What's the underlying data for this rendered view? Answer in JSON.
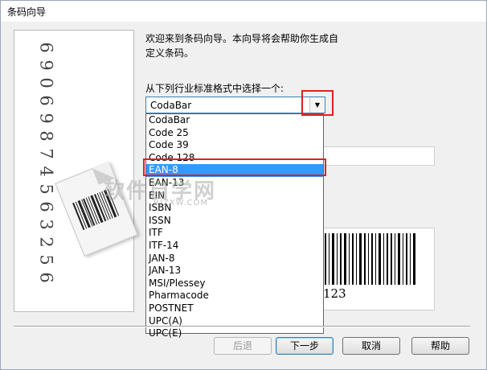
{
  "window": {
    "title": "条码向导"
  },
  "intro_text": "欢迎来到条码向导。本向导将会帮助你生成自定义条码。",
  "select_label": "从下列行业标准格式中选择一个:",
  "select": {
    "value": "CodaBar",
    "arrow_icon": "chevron-down-icon"
  },
  "list": {
    "items": [
      "CodaBar",
      "Code 25",
      "Code 39",
      "Code 128",
      "EAN-8",
      "EAN-13",
      "EIN",
      "ISBN",
      "ISSN",
      "ITF",
      "ITF-14",
      "JAN-8",
      "JAN-13",
      "MSI/Plessey",
      "Pharmacode",
      "POSTNET",
      "UPC(A)",
      "UPC(E)"
    ],
    "selected": "EAN-8"
  },
  "left_panel": {
    "digits": [
      "6",
      "9",
      "0",
      "6",
      "9",
      "8",
      "7",
      "4",
      "5",
      "6",
      "3",
      "2",
      "5",
      "6"
    ]
  },
  "preview": {
    "text": "123"
  },
  "watermark": {
    "main": "软件自学网",
    "sub": "RJZXW.COM"
  },
  "buttons": {
    "back": "后退",
    "next": "下一步",
    "cancel": "取消",
    "help": "帮助"
  },
  "colors": {
    "highlight": "#3399ff",
    "annotation": "#e02020"
  }
}
